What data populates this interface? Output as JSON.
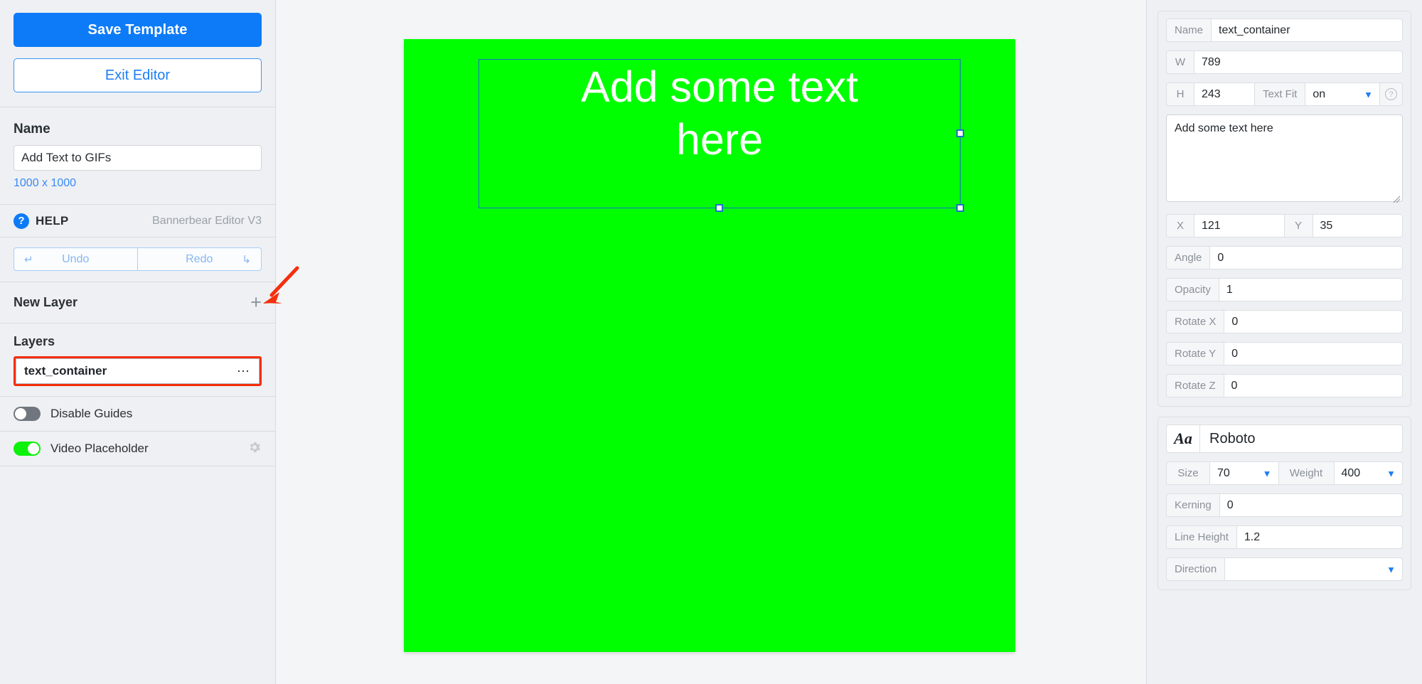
{
  "sidebar": {
    "save_label": "Save Template",
    "exit_label": "Exit Editor",
    "name_heading": "Name",
    "name_value": "Add Text to GIFs",
    "dimensions": "1000 x 1000",
    "help_label": "HELP",
    "help_icon": "question-circle-icon",
    "version": "Bannerbear Editor V3",
    "undo_label": "Undo",
    "redo_label": "Redo",
    "undo_icon": "undo-arrow-icon",
    "redo_icon": "redo-arrow-icon",
    "new_layer_label": "New Layer",
    "add_icon": "plus-icon",
    "layers_heading": "Layers",
    "layers": [
      {
        "name": "text_container",
        "menu_icon": "ellipsis-icon"
      }
    ],
    "toggles": [
      {
        "label": "Disable Guides",
        "state": "off"
      },
      {
        "label": "Video Placeholder",
        "state": "on",
        "settings_icon": "gear-icon"
      }
    ]
  },
  "canvas": {
    "background_color": "#00ff00",
    "selection_text": "Add some text\nhere",
    "selection_color": "#1a73c8",
    "handles": [
      "east-handle",
      "south-handle",
      "south-east-handle"
    ]
  },
  "annotation": {
    "arrow_color": "#f4300d",
    "arrow_icon": "red-arrow-icon"
  },
  "properties": {
    "name_label": "Name",
    "name_value": "text_container",
    "w_label": "W",
    "w_value": "789",
    "h_label": "H",
    "h_value": "243",
    "text_fit_label": "Text Fit",
    "text_fit_value": "on",
    "text_fit_help_icon": "question-mark-icon",
    "text_content": "Add some text here",
    "x_label": "X",
    "x_value": "121",
    "y_label": "Y",
    "y_value": "35",
    "angle_label": "Angle",
    "angle_value": "0",
    "opacity_label": "Opacity",
    "opacity_value": "1",
    "rotate_x_label": "Rotate X",
    "rotate_x_value": "0",
    "rotate_y_label": "Rotate Y",
    "rotate_y_value": "0",
    "rotate_z_label": "Rotate Z",
    "rotate_z_value": "0"
  },
  "typography": {
    "font_glyph": "Aa",
    "font_family": "Roboto",
    "size_label": "Size",
    "size_value": "70",
    "weight_label": "Weight",
    "weight_value": "400",
    "kerning_label": "Kerning",
    "kerning_value": "0",
    "line_height_label": "Line Height",
    "line_height_value": "1.2",
    "direction_label": "Direction",
    "direction_value": ""
  },
  "colors": {
    "accent_blue": "#0d7bf7",
    "annotation_red": "#f52d0a",
    "canvas_green": "#00ff00",
    "toggle_on_green": "#0bf10b"
  }
}
